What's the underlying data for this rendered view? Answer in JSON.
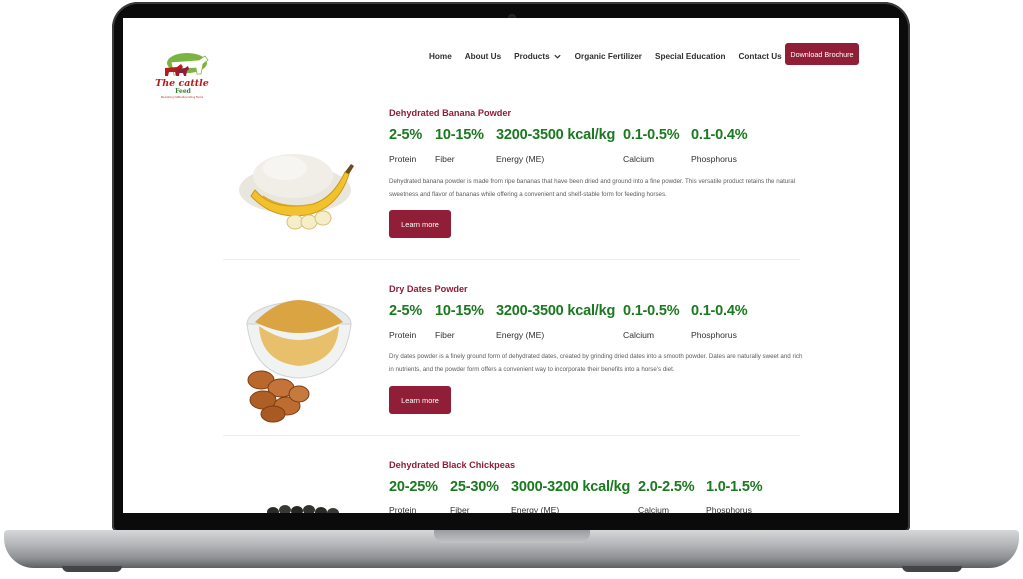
{
  "brand": {
    "logo_text": "The cattle",
    "logo_subtext": "Feed",
    "logo_tagline": "Nourishing Cattle Nourishing Farms"
  },
  "nav": {
    "items": [
      "Home",
      "About Us",
      "Products",
      "Organic Fertilizer",
      "Special Education",
      "Contact Us"
    ],
    "brochure_label": "Download Brochure"
  },
  "products": [
    {
      "title": "Dehydrated Banana Powder",
      "stats": [
        {
          "value": "2-5%",
          "label": "Protein"
        },
        {
          "value": "10-15%",
          "label": "Fiber"
        },
        {
          "value": "3200-3500 kcal/kg",
          "label": "Energy (ME)"
        },
        {
          "value": "0.1-0.5%",
          "label": "Calcium"
        },
        {
          "value": "0.1-0.4%",
          "label": "Phosphorus"
        }
      ],
      "description": "Dehydrated banana powder is made from ripe bananas that have been dried and ground into a fine powder. This versatile product retains the natural sweetness and flavor of bananas while offering a convenient and shelf-stable form for feeding horses.",
      "button": "Learn more"
    },
    {
      "title": "Dry Dates Powder",
      "stats": [
        {
          "value": "2-5%",
          "label": "Protein"
        },
        {
          "value": "10-15%",
          "label": "Fiber"
        },
        {
          "value": "3200-3500 kcal/kg",
          "label": "Energy (ME)"
        },
        {
          "value": "0.1-0.5%",
          "label": "Calcium"
        },
        {
          "value": "0.1-0.4%",
          "label": "Phosphorus"
        }
      ],
      "description": "Dry dates powder is a finely ground form of dehydrated dates, created by grinding dried dates into a smooth powder. Dates are naturally sweet and rich in nutrients, and the powder form offers a convenient way to incorporate their benefits into a horse's diet.",
      "button": "Learn more"
    },
    {
      "title": "Dehydrated Black Chickpeas",
      "stats": [
        {
          "value": "20-25%",
          "label": "Protein"
        },
        {
          "value": "25-30%",
          "label": "Fiber"
        },
        {
          "value": "3000-3200 kcal/kg",
          "label": "Energy (ME)"
        },
        {
          "value": "2.0-2.5%",
          "label": "Calcium"
        },
        {
          "value": "1.0-1.5%",
          "label": "Phosphorus"
        }
      ]
    }
  ],
  "colors": {
    "brand": "#8f1e36",
    "stat_green": "#1a7a1f",
    "text": "#2f3033"
  }
}
